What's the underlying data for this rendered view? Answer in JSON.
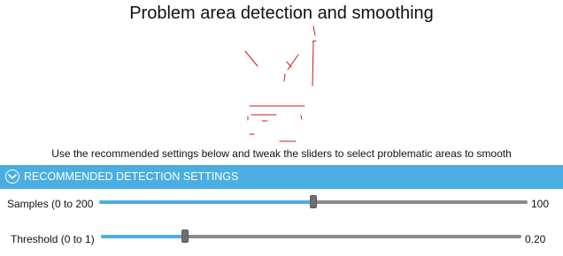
{
  "title": "Problem area detection and smoothing",
  "instructions": "Use the recommended settings below and tweak the sliders to select problematic areas to smooth",
  "section": {
    "label": "RECOMMENDED DETECTION SETTINGS",
    "icon": "chevron-down-circle-icon",
    "color": "#4aaee2"
  },
  "sliders": {
    "samples": {
      "label": "Samples (0 to 200",
      "value_text": "100",
      "min": 0,
      "max": 200,
      "value": 100
    },
    "threshold": {
      "label": "Threshold (0 to 1)",
      "value_text": "0.20",
      "min": 0,
      "max": 1,
      "value": 0.2
    }
  },
  "colors": {
    "accent": "#4aaee2",
    "track": "#8a8a8a",
    "thumb": "#6f6f6f",
    "problem_marks": "#cc1a1a"
  }
}
